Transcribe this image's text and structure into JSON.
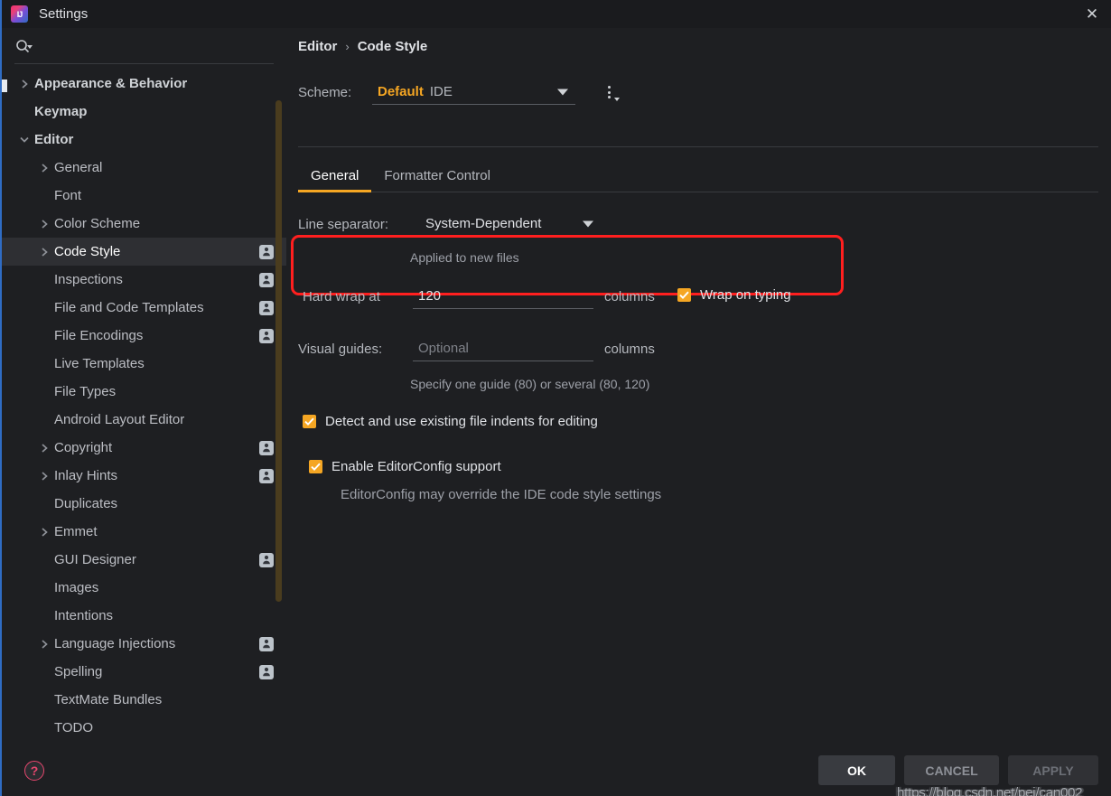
{
  "window": {
    "title": "Settings",
    "logo_icon": "intellij-idea-logo",
    "close_icon": "close-icon"
  },
  "sidebar": {
    "search": {
      "placeholder": "",
      "value": "",
      "icon": "search-icon"
    },
    "items": [
      {
        "label": "Appearance & Behavior",
        "indent": 0,
        "twisty": "right",
        "bold": true,
        "selected": false,
        "profile": false
      },
      {
        "label": "Keymap",
        "indent": 0,
        "twisty": "none",
        "bold": true,
        "selected": false,
        "profile": false
      },
      {
        "label": "Editor",
        "indent": 0,
        "twisty": "down",
        "bold": true,
        "selected": false,
        "profile": false
      },
      {
        "label": "General",
        "indent": 1,
        "twisty": "right",
        "bold": false,
        "selected": false,
        "profile": false
      },
      {
        "label": "Font",
        "indent": 1,
        "twisty": "none",
        "bold": false,
        "selected": false,
        "profile": false
      },
      {
        "label": "Color Scheme",
        "indent": 1,
        "twisty": "right",
        "bold": false,
        "selected": false,
        "profile": false
      },
      {
        "label": "Code Style",
        "indent": 1,
        "twisty": "right",
        "bold": false,
        "selected": true,
        "profile": true
      },
      {
        "label": "Inspections",
        "indent": 1,
        "twisty": "none",
        "bold": false,
        "selected": false,
        "profile": true
      },
      {
        "label": "File and Code Templates",
        "indent": 1,
        "twisty": "none",
        "bold": false,
        "selected": false,
        "profile": true
      },
      {
        "label": "File Encodings",
        "indent": 1,
        "twisty": "none",
        "bold": false,
        "selected": false,
        "profile": true
      },
      {
        "label": "Live Templates",
        "indent": 1,
        "twisty": "none",
        "bold": false,
        "selected": false,
        "profile": false
      },
      {
        "label": "File Types",
        "indent": 1,
        "twisty": "none",
        "bold": false,
        "selected": false,
        "profile": false
      },
      {
        "label": "Android Layout Editor",
        "indent": 1,
        "twisty": "none",
        "bold": false,
        "selected": false,
        "profile": false
      },
      {
        "label": "Copyright",
        "indent": 1,
        "twisty": "right",
        "bold": false,
        "selected": false,
        "profile": true
      },
      {
        "label": "Inlay Hints",
        "indent": 1,
        "twisty": "right",
        "bold": false,
        "selected": false,
        "profile": true
      },
      {
        "label": "Duplicates",
        "indent": 1,
        "twisty": "none",
        "bold": false,
        "selected": false,
        "profile": false
      },
      {
        "label": "Emmet",
        "indent": 1,
        "twisty": "right",
        "bold": false,
        "selected": false,
        "profile": false
      },
      {
        "label": "GUI Designer",
        "indent": 1,
        "twisty": "none",
        "bold": false,
        "selected": false,
        "profile": true
      },
      {
        "label": "Images",
        "indent": 1,
        "twisty": "none",
        "bold": false,
        "selected": false,
        "profile": false
      },
      {
        "label": "Intentions",
        "indent": 1,
        "twisty": "none",
        "bold": false,
        "selected": false,
        "profile": false
      },
      {
        "label": "Language Injections",
        "indent": 1,
        "twisty": "right",
        "bold": false,
        "selected": false,
        "profile": true
      },
      {
        "label": "Spelling",
        "indent": 1,
        "twisty": "none",
        "bold": false,
        "selected": false,
        "profile": true
      },
      {
        "label": "TextMate Bundles",
        "indent": 1,
        "twisty": "none",
        "bold": false,
        "selected": false,
        "profile": false
      },
      {
        "label": "TODO",
        "indent": 1,
        "twisty": "none",
        "bold": false,
        "selected": false,
        "profile": false
      }
    ],
    "help_icon": "help-question-icon"
  },
  "main": {
    "breadcrumb": {
      "parent": "Editor",
      "separator": "›",
      "current": "Code Style"
    },
    "scheme": {
      "label": "Scheme:",
      "value_primary": "Default",
      "value_secondary": "IDE",
      "dropdown_icon": "chevron-down-icon",
      "more_icon": "more-options-icon"
    },
    "tabs": [
      {
        "label": "General",
        "active": true
      },
      {
        "label": "Formatter Control",
        "active": false
      }
    ],
    "line_separator": {
      "label": "Line separator:",
      "value": "System-Dependent",
      "hint": "Applied to new files",
      "dropdown_icon": "chevron-down-icon"
    },
    "hard_wrap": {
      "label": "Hard wrap at",
      "value": "120",
      "unit": "columns",
      "wrap_on_typing": {
        "label": "Wrap on typing",
        "checked": true
      }
    },
    "visual_guides": {
      "label": "Visual guides:",
      "placeholder": "Optional",
      "value": "",
      "unit": "columns",
      "hint": "Specify one guide (80) or several (80, 120)"
    },
    "detect_indents": {
      "label": "Detect and use existing file indents for editing",
      "checked": true
    },
    "editorconfig": {
      "label": "Enable EditorConfig support",
      "checked": true,
      "hint": "EditorConfig may override the IDE code style settings"
    }
  },
  "footer": {
    "ok": "OK",
    "cancel": "CANCEL",
    "apply": "APPLY",
    "watermark": "https://blog.csdn.net/pei/can002"
  },
  "colors": {
    "accent_orange": "#f5a623",
    "annotation_red": "#ff1f1f",
    "selection_bg": "#2e2f33",
    "panel_bg": "#1e1f22",
    "titlebar_bg": "#1a1b1e"
  }
}
